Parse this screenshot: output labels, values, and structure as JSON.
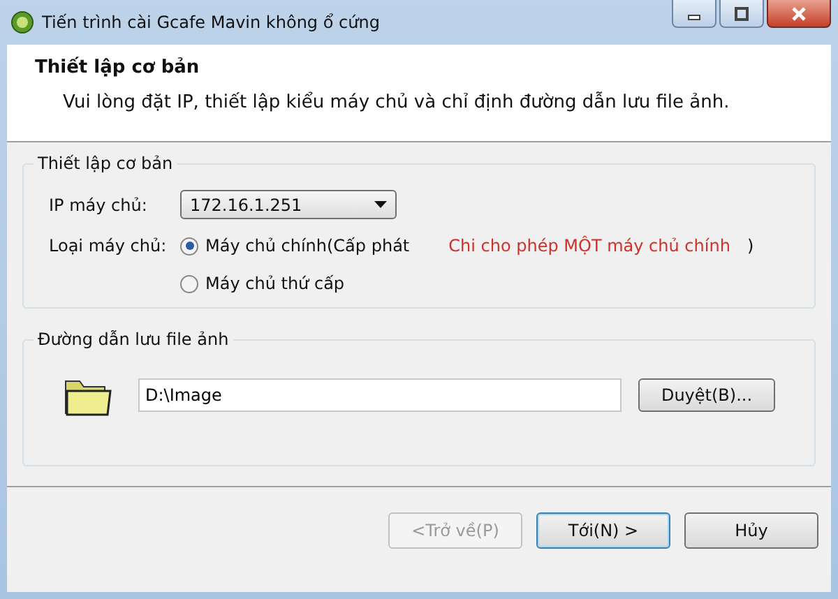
{
  "window": {
    "title": "Tiến trình cài  Gcafe Mavin không ổ cứng"
  },
  "header": {
    "title": "Thiết lập cơ bản",
    "subtitle": "Vui lòng đặt IP, thiết lập kiểu máy chủ và chỉ định đường dẫn lưu file ảnh."
  },
  "basic_group": {
    "title": "Thiết lập cơ bản",
    "ip_label": "IP máy chủ:",
    "ip_value": "172.16.1.251",
    "type_label": "Loại máy chủ:",
    "server_types": [
      {
        "label": "Máy chủ chính(Cấp phát",
        "note": "Chi cho phép MỘT máy chủ chính",
        "close": ")",
        "selected": true
      },
      {
        "label": "Máy chủ thứ cấp",
        "selected": false
      }
    ]
  },
  "path_group": {
    "title": "Đường dẫn lưu file ảnh",
    "value": "D:\\Image",
    "browse": "Duyệt(B)..."
  },
  "buttons": [
    {
      "label": "<Trở về(P)",
      "disabled": true,
      "default": false
    },
    {
      "label": "Tới(N) >",
      "disabled": false,
      "default": true
    },
    {
      "label": "Hủy",
      "disabled": false,
      "default": false
    }
  ]
}
